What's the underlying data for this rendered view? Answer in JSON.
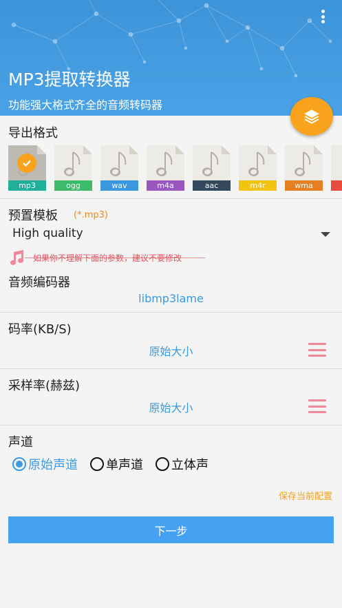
{
  "header": {
    "title": "MP3提取转换器",
    "subtitle": "功能强大格式齐全的音频转码器",
    "menu_icon": "more-vert-icon",
    "fab_icon": "layers-icon"
  },
  "export_format": {
    "title": "导出格式",
    "selected": "mp3",
    "formats": [
      {
        "label": "mp3",
        "color": "#20b09a"
      },
      {
        "label": "ogg",
        "color": "#3dbb6a"
      },
      {
        "label": "wav",
        "color": "#3a98df"
      },
      {
        "label": "m4a",
        "color": "#9b57c0"
      },
      {
        "label": "aac",
        "color": "#34495e"
      },
      {
        "label": "m4r",
        "color": "#f1c40f"
      },
      {
        "label": "wma",
        "color": "#e67e22"
      }
    ]
  },
  "preset": {
    "title": "预置模板",
    "hint": "(*.mp3)",
    "value": "High quality"
  },
  "warning": "如果你不理解下面的参数，建议不要修改",
  "codec": {
    "title": "音频编码器",
    "value": "libmp3lame"
  },
  "bitrate": {
    "title": "码率(KB/S)",
    "value": "原始大小"
  },
  "samplerate": {
    "title": "采样率(赫兹)",
    "value": "原始大小"
  },
  "channel": {
    "title": "声道",
    "options": [
      "原始声道",
      "单声道",
      "立体声"
    ],
    "selected": "原始声道"
  },
  "save_config": "保存当前配置",
  "next_button": "下一步",
  "colors": {
    "header": "#4aa3e6",
    "accent_orange": "#f9a21b",
    "accent_blue": "#3d9ae0",
    "warning_red": "#e2555e"
  }
}
